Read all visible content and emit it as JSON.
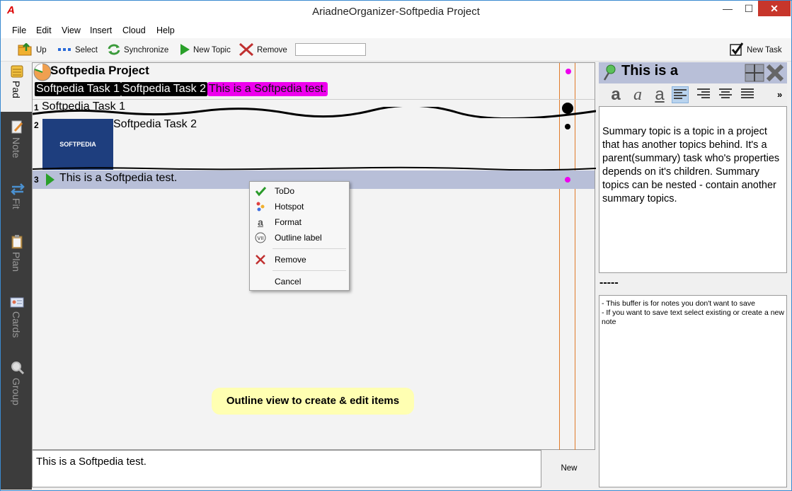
{
  "window": {
    "app_icon": "A",
    "title": "AriadneOrganizer-Softpedia Project",
    "min": "—",
    "max": "☐",
    "close": "✕"
  },
  "menu": [
    "File",
    "Edit",
    "View",
    "Insert",
    "Cloud",
    "Help"
  ],
  "toolbar": {
    "up": "Up",
    "select": "Select",
    "synchronize": "Synchronize",
    "new_topic": "New Topic",
    "remove": "Remove",
    "search_value": "",
    "new_task": "New Task"
  },
  "sidetabs": [
    "Pad",
    "Note",
    "Fit",
    "Plan",
    "Cards",
    "Group"
  ],
  "outline": {
    "project_title": "Softpedia Project",
    "chips": [
      "Softpedia Task 1",
      "Softpedia Task 2",
      "This is a Softpedia test."
    ],
    "rows": [
      {
        "num": "1",
        "text": "Softpedia Task 1"
      },
      {
        "num": "2",
        "text": "Softpedia Task 2",
        "image_label": "SOFTPEDIA"
      },
      {
        "num": "3",
        "text": "This is a Softpedia test."
      }
    ],
    "hint": "Outline view to create & edit items"
  },
  "context_menu": {
    "todo": "ToDo",
    "hotspot": "Hotspot",
    "format": "Format",
    "outline_label": "Outline label",
    "remove": "Remove",
    "cancel": "Cancel"
  },
  "bottom": {
    "text": "This is a Softpedia test.",
    "new_button": "New"
  },
  "right_panel": {
    "title": "This is a",
    "summary": "Summary topic is a topic in a project that has another topics behind. It's a parent(summary) task who's properties depends on it's children. Summary topics can be nested - contain another summary topics.",
    "separator": "-----",
    "notes_line1": "- This buffer is for notes you don't want to save",
    "notes_line2": "- If you want to save text select existing or create a new note",
    "more": "»"
  },
  "colors": {
    "accent_magenta": "#ee00ee",
    "selected_row": "#b8bfd8",
    "hint_bg": "#ffffb2",
    "guide_line": "#e07a2a"
  }
}
